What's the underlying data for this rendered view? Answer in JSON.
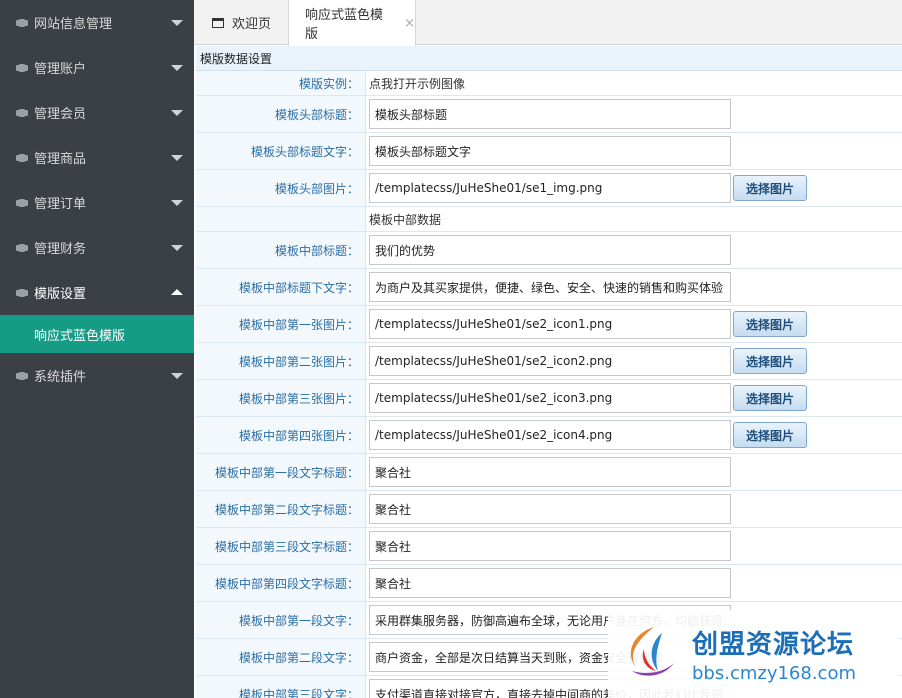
{
  "sidebar": {
    "items": [
      {
        "label": "网站信息管理"
      },
      {
        "label": "管理账户"
      },
      {
        "label": "管理会员"
      },
      {
        "label": "管理商品"
      },
      {
        "label": "管理订单"
      },
      {
        "label": "管理财务"
      },
      {
        "label": "模版设置"
      },
      {
        "label": "系统插件"
      }
    ],
    "sub_item": "响应式蓝色模版"
  },
  "tabs": {
    "welcome": "欢迎页",
    "active": "响应式蓝色模版",
    "close": "×"
  },
  "form": {
    "section_title": "模版数据设置",
    "sub_section": "模板中部数据",
    "button_label": "选择图片",
    "rows": [
      {
        "label": "模版实例：",
        "value": "点我打开示例图像"
      },
      {
        "label": "模板头部标题：",
        "value": "模板头部标题"
      },
      {
        "label": "模板头部标题文字：",
        "value": "模板头部标题文字"
      },
      {
        "label": "模板头部图片：",
        "value": "/templatecss/JuHeShe01/se1_img.png"
      },
      {
        "label": "模板中部标题：",
        "value": "我们的优势"
      },
      {
        "label": "模板中部标题下文字：",
        "value": "为商户及其买家提供，便捷、绿色、安全、快速的销售和购买体验"
      },
      {
        "label": "模板中部第一张图片：",
        "value": "/templatecss/JuHeShe01/se2_icon1.png"
      },
      {
        "label": "模板中部第二张图片：",
        "value": "/templatecss/JuHeShe01/se2_icon2.png"
      },
      {
        "label": "模板中部第三张图片：",
        "value": "/templatecss/JuHeShe01/se2_icon3.png"
      },
      {
        "label": "模板中部第四张图片：",
        "value": "/templatecss/JuHeShe01/se2_icon4.png"
      },
      {
        "label": "模板中部第一段文字标题：",
        "value": "聚合社"
      },
      {
        "label": "模板中部第二段文字标题：",
        "value": "聚合社"
      },
      {
        "label": "模板中部第三段文字标题：",
        "value": "聚合社"
      },
      {
        "label": "模板中部第四段文字标题：",
        "value": "聚合社"
      },
      {
        "label": "模板中部第一段文字：",
        "value": "采用群集服务器，防御高遍布全球，无论用户身在何方，均能获得流畅"
      },
      {
        "label": "模板中部第二段文字：",
        "value": "商户资金，全部是次日结算当天到账，资金安全有保障"
      },
      {
        "label": "模板中部第三段文字：",
        "value": "支付渠道直接对接官方，直接去掉中间商的差价，因此我们比我司"
      }
    ]
  },
  "watermark": {
    "title": "创盟资源论坛",
    "url": "bbs.cmzy168.com"
  }
}
